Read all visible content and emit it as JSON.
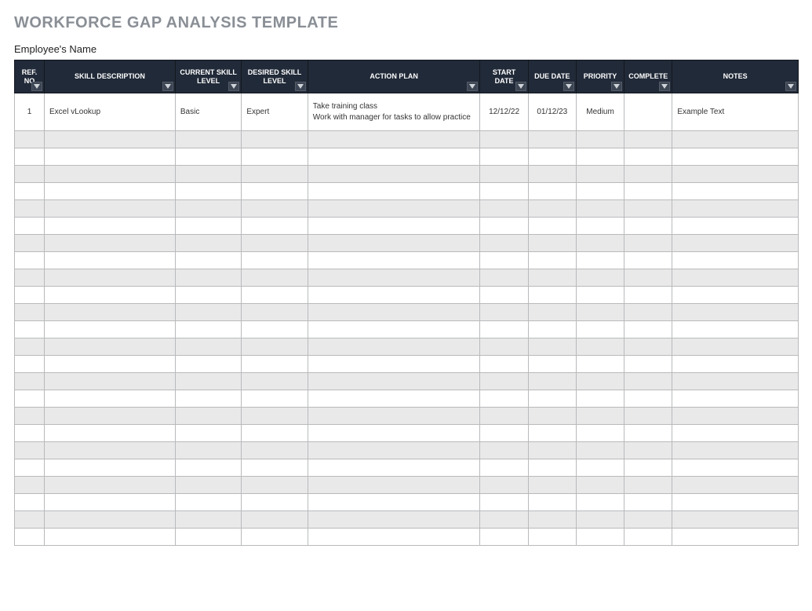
{
  "title": "WORKFORCE GAP ANALYSIS TEMPLATE",
  "subheader": "Employee's Name",
  "columns": {
    "ref": "REF. NO",
    "skill": "SKILL DESCRIPTION",
    "current": "CURRENT SKILL LEVEL",
    "desired": "DESIRED SKILL LEVEL",
    "action": "ACTION PLAN",
    "start": "START DATE",
    "due": "DUE DATE",
    "priority": "PRIORITY",
    "complete": "COMPLETE",
    "notes": "NOTES"
  },
  "rows": [
    {
      "ref": "1",
      "skill": "Excel vLookup",
      "current": "Basic",
      "desired": "Expert",
      "action": "Take training class\nWork with manager for tasks to allow practice",
      "start": "12/12/22",
      "due": "01/12/23",
      "priority": "Medium",
      "complete": "",
      "notes": "Example Text"
    }
  ],
  "empty_row_count": 24
}
